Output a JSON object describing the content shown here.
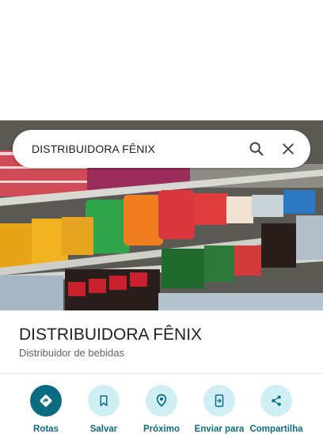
{
  "search": {
    "query": "DISTRIBUIDORA FÊNIX"
  },
  "place": {
    "title": "DISTRIBUIDORA FÊNIX",
    "category": "Distribuidor de bebidas"
  },
  "actions": [
    {
      "label": "Rotas",
      "icon": "directions-icon"
    },
    {
      "label": "Salvar",
      "icon": "bookmark-icon"
    },
    {
      "label": "Próximo",
      "icon": "nearby-icon"
    },
    {
      "label": "Enviar para",
      "icon": "send-to-phone-icon"
    },
    {
      "label": "Compartilha",
      "icon": "share-icon"
    }
  ],
  "colors": {
    "accent": "#0a6c80",
    "action_bg": "#cfeff5",
    "text_primary": "#202124",
    "text_secondary": "#5f6368"
  }
}
